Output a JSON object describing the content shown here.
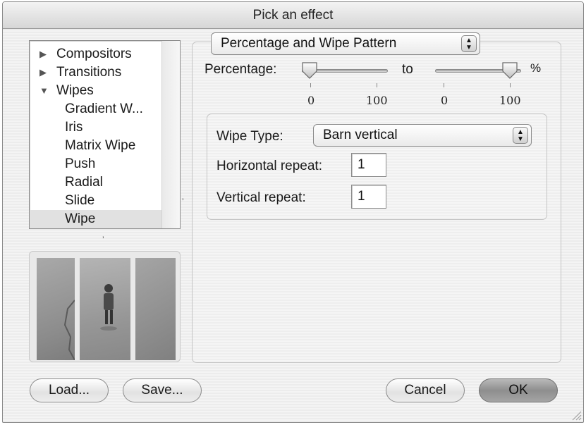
{
  "window": {
    "title": "Pick an effect"
  },
  "tree": {
    "items": [
      {
        "label": "Compositors",
        "type": "category",
        "expanded": false
      },
      {
        "label": "Transitions",
        "type": "category",
        "expanded": false
      },
      {
        "label": "Wipes",
        "type": "category",
        "expanded": true
      },
      {
        "label": "Gradient W...",
        "type": "effect"
      },
      {
        "label": "Iris",
        "type": "effect"
      },
      {
        "label": "Matrix Wipe",
        "type": "effect"
      },
      {
        "label": "Push",
        "type": "effect"
      },
      {
        "label": "Radial",
        "type": "effect"
      },
      {
        "label": "Slide",
        "type": "effect"
      },
      {
        "label": "Wipe",
        "type": "effect",
        "selected": true
      }
    ]
  },
  "parameters": {
    "mode_popup": "Percentage and Wipe Pattern",
    "percentage_label": "Percentage:",
    "to_label": "to",
    "percent_sign": "%",
    "start_slider": {
      "value": 0,
      "min_label": "0",
      "max_label": "100"
    },
    "end_slider": {
      "value": 100,
      "min_label": "0",
      "max_label": "100"
    },
    "wipe_type_label": "Wipe Type:",
    "wipe_type_value": "Barn vertical",
    "horizontal_repeat_label": "Horizontal repeat:",
    "horizontal_repeat_value": "1",
    "vertical_repeat_label": "Vertical repeat:",
    "vertical_repeat_value": "1"
  },
  "buttons": {
    "load": "Load...",
    "save": "Save...",
    "cancel": "Cancel",
    "ok": "OK"
  },
  "colors": {
    "window_bg": "#ececec",
    "default_button": "#9a9a9a"
  }
}
